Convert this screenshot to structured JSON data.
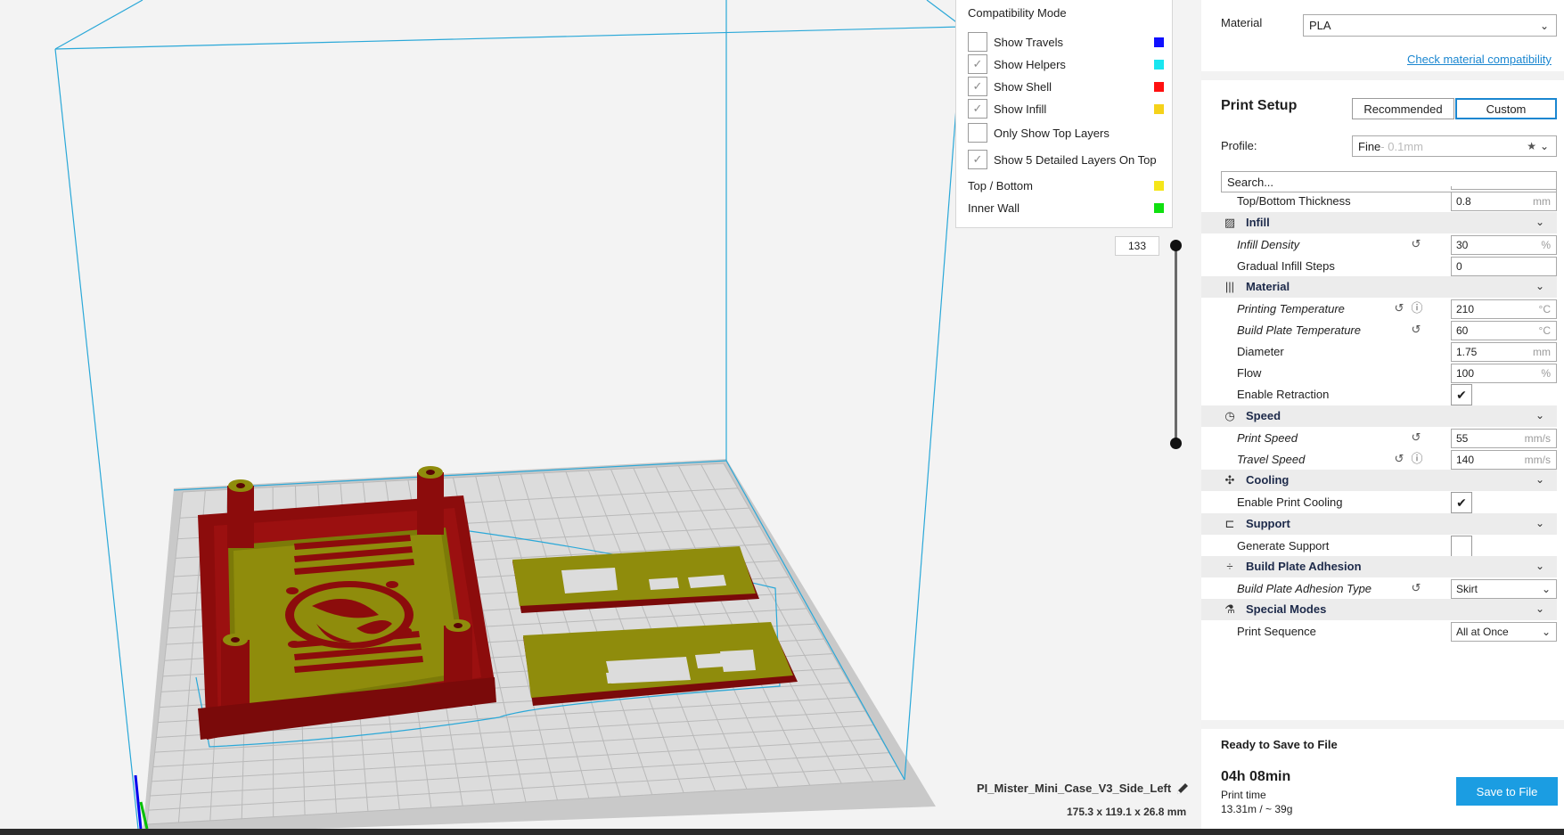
{
  "legend": {
    "title": "Compatibility Mode",
    "rows": [
      {
        "label": "Show Travels",
        "checked": false,
        "color": "#1010ff"
      },
      {
        "label": "Show Helpers",
        "checked": true,
        "color": "#19e6f0"
      },
      {
        "label": "Show Shell",
        "checked": true,
        "color": "#ff1010"
      },
      {
        "label": "Show Infill",
        "checked": true,
        "color": "#f5d21a"
      },
      {
        "label": "Only Show Top Layers",
        "checked": false
      },
      {
        "label": "Show 5 Detailed Layers On Top",
        "checked": true
      }
    ],
    "types": [
      {
        "label": "Top / Bottom",
        "color": "#f5e61a"
      },
      {
        "label": "Inner Wall",
        "color": "#10e010"
      }
    ]
  },
  "layer_slider": {
    "value": "133"
  },
  "file": {
    "name": "PI_Mister_Mini_Case_V3_Side_Left",
    "dimensions": "175.3 x 119.1 x 26.8 mm"
  },
  "panel": {
    "material_label": "Material",
    "material_value": "PLA",
    "check_compat": "Check material compatibility",
    "print_setup": "Print Setup",
    "mode_recommended": "Recommended",
    "mode_custom": "Custom",
    "profile_label": "Profile:",
    "profile_value": "Fine",
    "profile_suffix": " - 0.1mm",
    "search_placeholder": "Search...",
    "settings": {
      "top_bottom_thickness": {
        "label": "Top/Bottom Thickness",
        "value": "0.8",
        "unit": "mm"
      },
      "infill": "Infill",
      "infill_density": {
        "label": "Infill Density",
        "value": "30",
        "unit": "%"
      },
      "gradual_infill": {
        "label": "Gradual Infill Steps",
        "value": "0"
      },
      "material": "Material",
      "printing_temp": {
        "label": "Printing Temperature",
        "value": "210",
        "unit": "°C"
      },
      "plate_temp": {
        "label": "Build Plate Temperature",
        "value": "60",
        "unit": "°C"
      },
      "diameter": {
        "label": "Diameter",
        "value": "1.75",
        "unit": "mm"
      },
      "flow": {
        "label": "Flow",
        "value": "100",
        "unit": "%"
      },
      "retraction": {
        "label": "Enable Retraction",
        "checked": true
      },
      "speed": "Speed",
      "print_speed": {
        "label": "Print Speed",
        "value": "55",
        "unit": "mm/s"
      },
      "travel_speed": {
        "label": "Travel Speed",
        "value": "140",
        "unit": "mm/s"
      },
      "cooling": "Cooling",
      "print_cooling": {
        "label": "Enable Print Cooling",
        "checked": true
      },
      "support": "Support",
      "generate_support": {
        "label": "Generate Support",
        "checked": false
      },
      "adhesion": "Build Plate Adhesion",
      "adhesion_type": {
        "label": "Build Plate Adhesion Type",
        "value": "Skirt"
      },
      "special": "Special Modes",
      "print_sequence": {
        "label": "Print Sequence",
        "value": "All at Once"
      }
    },
    "ready": "Ready to Save to File",
    "time": "04h 08min",
    "time_label": "Print time",
    "usage": "13.31m / ~ 39g",
    "save": "Save to File"
  }
}
